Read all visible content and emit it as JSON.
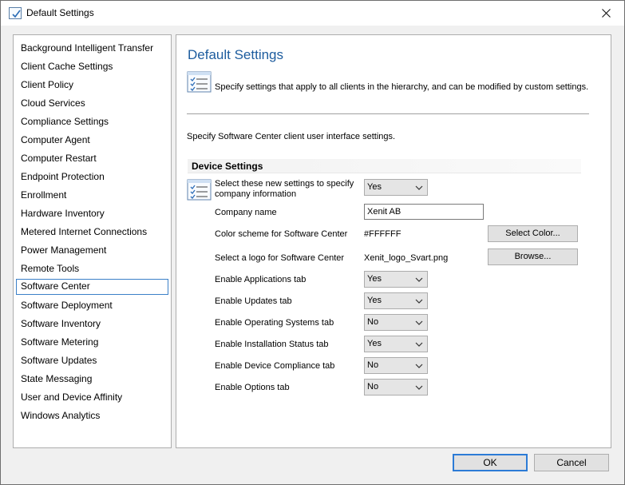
{
  "window": {
    "title": "Default Settings"
  },
  "nav": {
    "items": [
      {
        "label": "Background Intelligent Transfer"
      },
      {
        "label": "Client Cache Settings"
      },
      {
        "label": "Client Policy"
      },
      {
        "label": "Cloud Services"
      },
      {
        "label": "Compliance Settings"
      },
      {
        "label": "Computer Agent"
      },
      {
        "label": "Computer Restart"
      },
      {
        "label": "Endpoint Protection"
      },
      {
        "label": "Enrollment"
      },
      {
        "label": "Hardware Inventory"
      },
      {
        "label": "Metered Internet Connections"
      },
      {
        "label": "Power Management"
      },
      {
        "label": "Remote Tools"
      },
      {
        "label": "Software Center",
        "selected": true
      },
      {
        "label": "Software Deployment"
      },
      {
        "label": "Software Inventory"
      },
      {
        "label": "Software Metering"
      },
      {
        "label": "Software Updates"
      },
      {
        "label": "State Messaging"
      },
      {
        "label": "User and Device Affinity"
      },
      {
        "label": "Windows Analytics"
      }
    ]
  },
  "content": {
    "title": "Default Settings",
    "description": "Specify settings that apply to all clients in the hierarchy, and can be modified by custom settings.",
    "intro": "Specify Software Center client user interface settings.",
    "group_header": "Device Settings",
    "settings": {
      "custom_company": {
        "label_line1": "Select these new settings to specify",
        "label_line2": "company information",
        "value": "Yes"
      },
      "company_name": {
        "label": "Company name",
        "value": "Xenit AB"
      },
      "color_scheme": {
        "label": "Color scheme for Software Center",
        "value": "#FFFFFF",
        "button": "Select Color..."
      },
      "logo": {
        "label": "Select a logo for Software Center",
        "value": "Xenit_logo_Svart.png",
        "button": "Browse..."
      },
      "applications_tab": {
        "label": "Enable Applications tab",
        "value": "Yes"
      },
      "updates_tab": {
        "label": "Enable Updates tab",
        "value": "Yes"
      },
      "os_tab": {
        "label": "Enable Operating Systems tab",
        "value": "No"
      },
      "installation_status_tab": {
        "label": "Enable Installation Status tab",
        "value": "Yes"
      },
      "device_compliance_tab": {
        "label": "Enable Device Compliance tab",
        "value": "No"
      },
      "options_tab": {
        "label": "Enable Options tab",
        "value": "No"
      }
    },
    "select_options": [
      "Yes",
      "No"
    ]
  },
  "footer": {
    "ok_label": "OK",
    "cancel_label": "Cancel"
  },
  "colors": {
    "accent": "#1d5c9e",
    "selection_border": "#3b80c8",
    "default_button_border": "#2c7bd6"
  }
}
